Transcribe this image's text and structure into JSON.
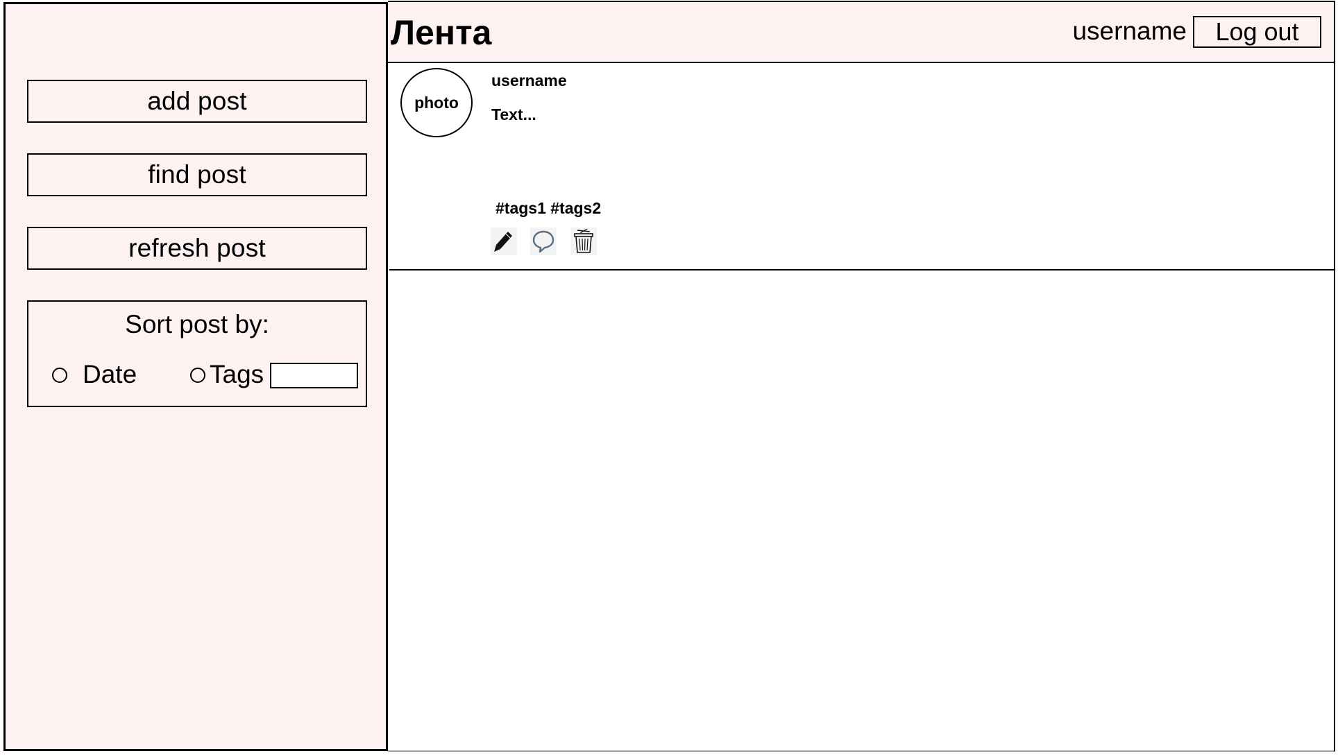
{
  "sidebar": {
    "buttons": {
      "add": "add post",
      "find": "find post",
      "refresh": "refresh post"
    },
    "sort": {
      "title": "Sort post by:",
      "options": [
        "Date",
        "Tags"
      ],
      "tags_value": ""
    }
  },
  "header": {
    "title": "Лента",
    "username": "username",
    "logout_label": "Log out"
  },
  "post": {
    "avatar_label": "photo",
    "username": "username",
    "text": "Text...",
    "tags": "#tags1 #tags2",
    "actions": [
      "pencil-icon",
      "speech-bubble-icon",
      "trash-icon"
    ]
  }
}
